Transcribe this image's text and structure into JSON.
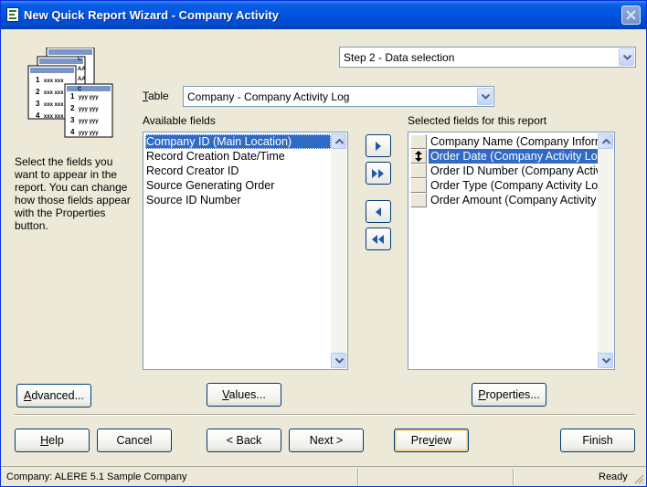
{
  "window": {
    "title": "New Quick Report Wizard - Company Activity"
  },
  "step": {
    "selected": "Step 2 - Data selection"
  },
  "table": {
    "label_underlined": "T",
    "label_rest": "able",
    "selected": "Company - Company Activity Log"
  },
  "instructions": "Select the fields you want to appear in the report. You can change how those fields appear with the Properties button.",
  "available": {
    "header": "Available fields",
    "items": [
      "Company ID (Main Location)",
      "Record Creation Date/Time",
      "Record Creator ID",
      "Source Generating Order",
      "Source ID Number"
    ],
    "selected_index": 0
  },
  "selected_fields": {
    "header": "Selected fields for this report",
    "items": [
      "Company Name (Company Inform",
      "Order Date (Company Activity Log",
      "Order ID Number (Company Activ",
      "Order Type (Company Activity Lo",
      "Order Amount (Company Activity"
    ],
    "selected_index": 1
  },
  "buttons": {
    "advanced_u": "A",
    "advanced_rest": "dvanced...",
    "values_u": "V",
    "values_rest": "alues...",
    "properties_u": "P",
    "properties_rest": "roperties...",
    "help_u": "H",
    "help_rest": "elp",
    "cancel": "Cancel",
    "back": "< Back",
    "next": "Next >",
    "preview_pre": "Pre",
    "preview_u": "v",
    "preview_rest": "iew",
    "finish": "Finish"
  },
  "status": {
    "company": "Company: ALERE 5.1 Sample Company",
    "state": "Ready"
  },
  "logo": {
    "rows": [
      {
        "num": "1",
        "text": "xxx xxx"
      },
      {
        "num": "2",
        "text": "xxx xxx"
      },
      {
        "num": "3",
        "text": "xxx xxx"
      },
      {
        "num": "4",
        "text": "xxx xxx"
      }
    ],
    "front_rows": [
      {
        "num": "1",
        "text": "yyy yyy"
      },
      {
        "num": "2",
        "text": "yyy yyy"
      },
      {
        "num": "3",
        "text": "yyy yyy"
      },
      {
        "num": "4",
        "text": "yyy yyy"
      }
    ],
    "side_letters": [
      "C",
      "AA",
      "AA",
      "C"
    ]
  },
  "colors": {
    "titlebar": "#0054e3",
    "selection": "#316ac5",
    "face": "#ece9d8"
  }
}
